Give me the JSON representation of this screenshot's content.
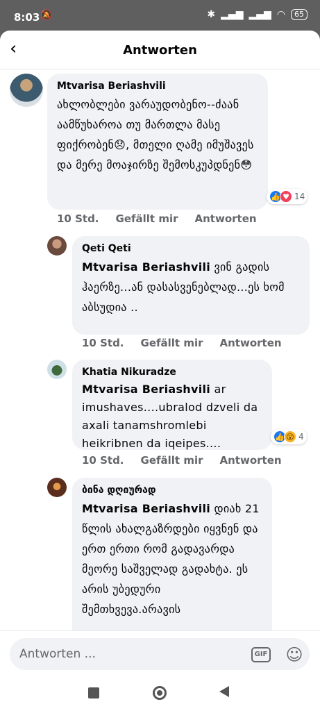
{
  "status_bar": {
    "time": "8:03",
    "battery": "65"
  },
  "header": {
    "title": "Antworten"
  },
  "comments": [
    {
      "author": "Mtvarisa Beriashvili",
      "text": "ახლობლები ვარაუდობენო--ძაან აამწუხაროა თუ მართლა მასე ფიქრობენ😞, მთელი ღამე იმუშავეს და მერე მოაჯირზე შემოსკუპდნენ😳",
      "time": "10 Std.",
      "like_label": "Gefällt mir",
      "reply_label": "Antworten",
      "reaction_count": "14",
      "reactions": [
        "like-icon",
        "love-icon"
      ]
    },
    {
      "author": "Qeti Qeti",
      "tag": "Mtvarisa Beriashvili",
      "text": "ვინ  გადის ჰაერზე...ან დასასვენებლად...ეს ხომ აბსუდია ..",
      "time": "10 Std.",
      "like_label": "Gefällt mir",
      "reply_label": "Antworten"
    },
    {
      "author": "Khatia Nikuradze",
      "tag": "Mtvarisa Beriashvili",
      "text": "ar imushaves....ubralod dzveli da axali tanamshromlebi heikribnen da iqeipes....",
      "time": "10 Std.",
      "like_label": "Gefällt mir",
      "reply_label": "Antworten",
      "reaction_count": "4",
      "reactions": [
        "like-icon",
        "wow-icon"
      ]
    },
    {
      "author": "ბინა დღიურად",
      "tag": "Mtvarisa Beriashvili",
      "text": "დიახ 21 წლის ახალგაზრდები იყვნენ და ერთ ერთი რომ გადავარდა მეორე საშველად გადახტა. ეს არის უბედური შემთხვევა.არავის"
    }
  ],
  "composer": {
    "placeholder": "Antworten ...",
    "gif_label": "GIF"
  },
  "colors": {
    "bubble": "#f0f2f5",
    "like": "#1877f2",
    "love": "#f33e58",
    "wow": "#f7b125",
    "muted_text": "#65676b"
  }
}
